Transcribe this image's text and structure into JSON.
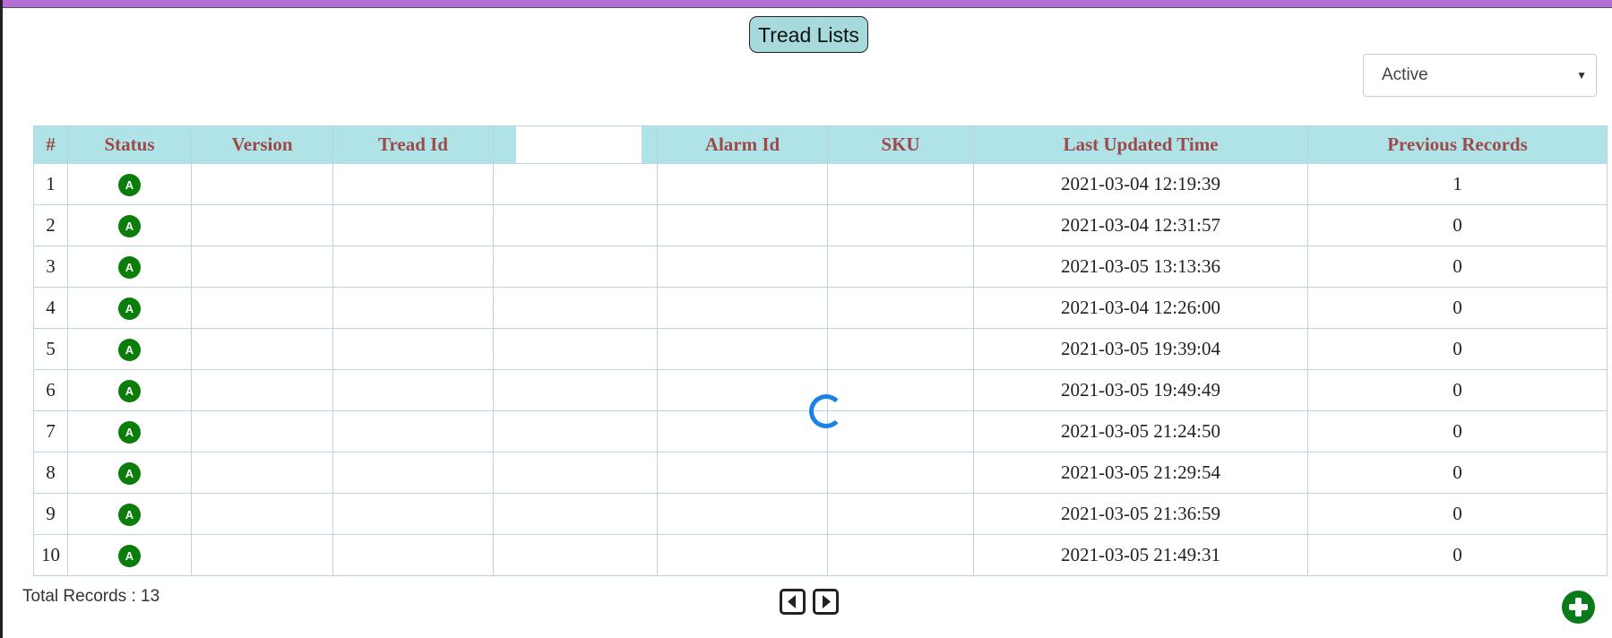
{
  "header": {
    "title": "Tread Lists"
  },
  "filter": {
    "status_selected": "Active"
  },
  "table": {
    "columns": [
      "#",
      "Status",
      "Version",
      "Tread Id",
      "",
      "Alarm Id",
      "SKU",
      "Last Updated Time",
      "Previous Records"
    ],
    "rows": [
      {
        "num": "1",
        "status": "A",
        "updated": "2021-03-04 12:19:39",
        "previous": "1"
      },
      {
        "num": "2",
        "status": "A",
        "updated": "2021-03-04 12:31:57",
        "previous": "0"
      },
      {
        "num": "3",
        "status": "A",
        "updated": "2021-03-05 13:13:36",
        "previous": "0"
      },
      {
        "num": "4",
        "status": "A",
        "updated": "2021-03-04 12:26:00",
        "previous": "0"
      },
      {
        "num": "5",
        "status": "A",
        "updated": "2021-03-05 19:39:04",
        "previous": "0"
      },
      {
        "num": "6",
        "status": "A",
        "updated": "2021-03-05 19:49:49",
        "previous": "0"
      },
      {
        "num": "7",
        "status": "A",
        "updated": "2021-03-05 21:24:50",
        "previous": "0"
      },
      {
        "num": "8",
        "status": "A",
        "updated": "2021-03-05 21:29:54",
        "previous": "0"
      },
      {
        "num": "9",
        "status": "A",
        "updated": "2021-03-05 21:36:59",
        "previous": "0"
      },
      {
        "num": "10",
        "status": "A",
        "updated": "2021-03-05 21:49:31",
        "previous": "0"
      }
    ]
  },
  "footer": {
    "total_records": "Total Records : 13"
  },
  "colors": {
    "top_bar": "#b46fd4",
    "header_bg": "#b0e3e7",
    "header_text": "#9c4a4a",
    "status_badge": "#0a7d0a",
    "spinner": "#1a82e6",
    "add_button": "#0b7a18"
  },
  "icons": {
    "prev": "caret-left-square-icon",
    "next": "caret-right-square-icon",
    "add": "plus-circle-icon",
    "loading": "loading-spinner-icon"
  }
}
